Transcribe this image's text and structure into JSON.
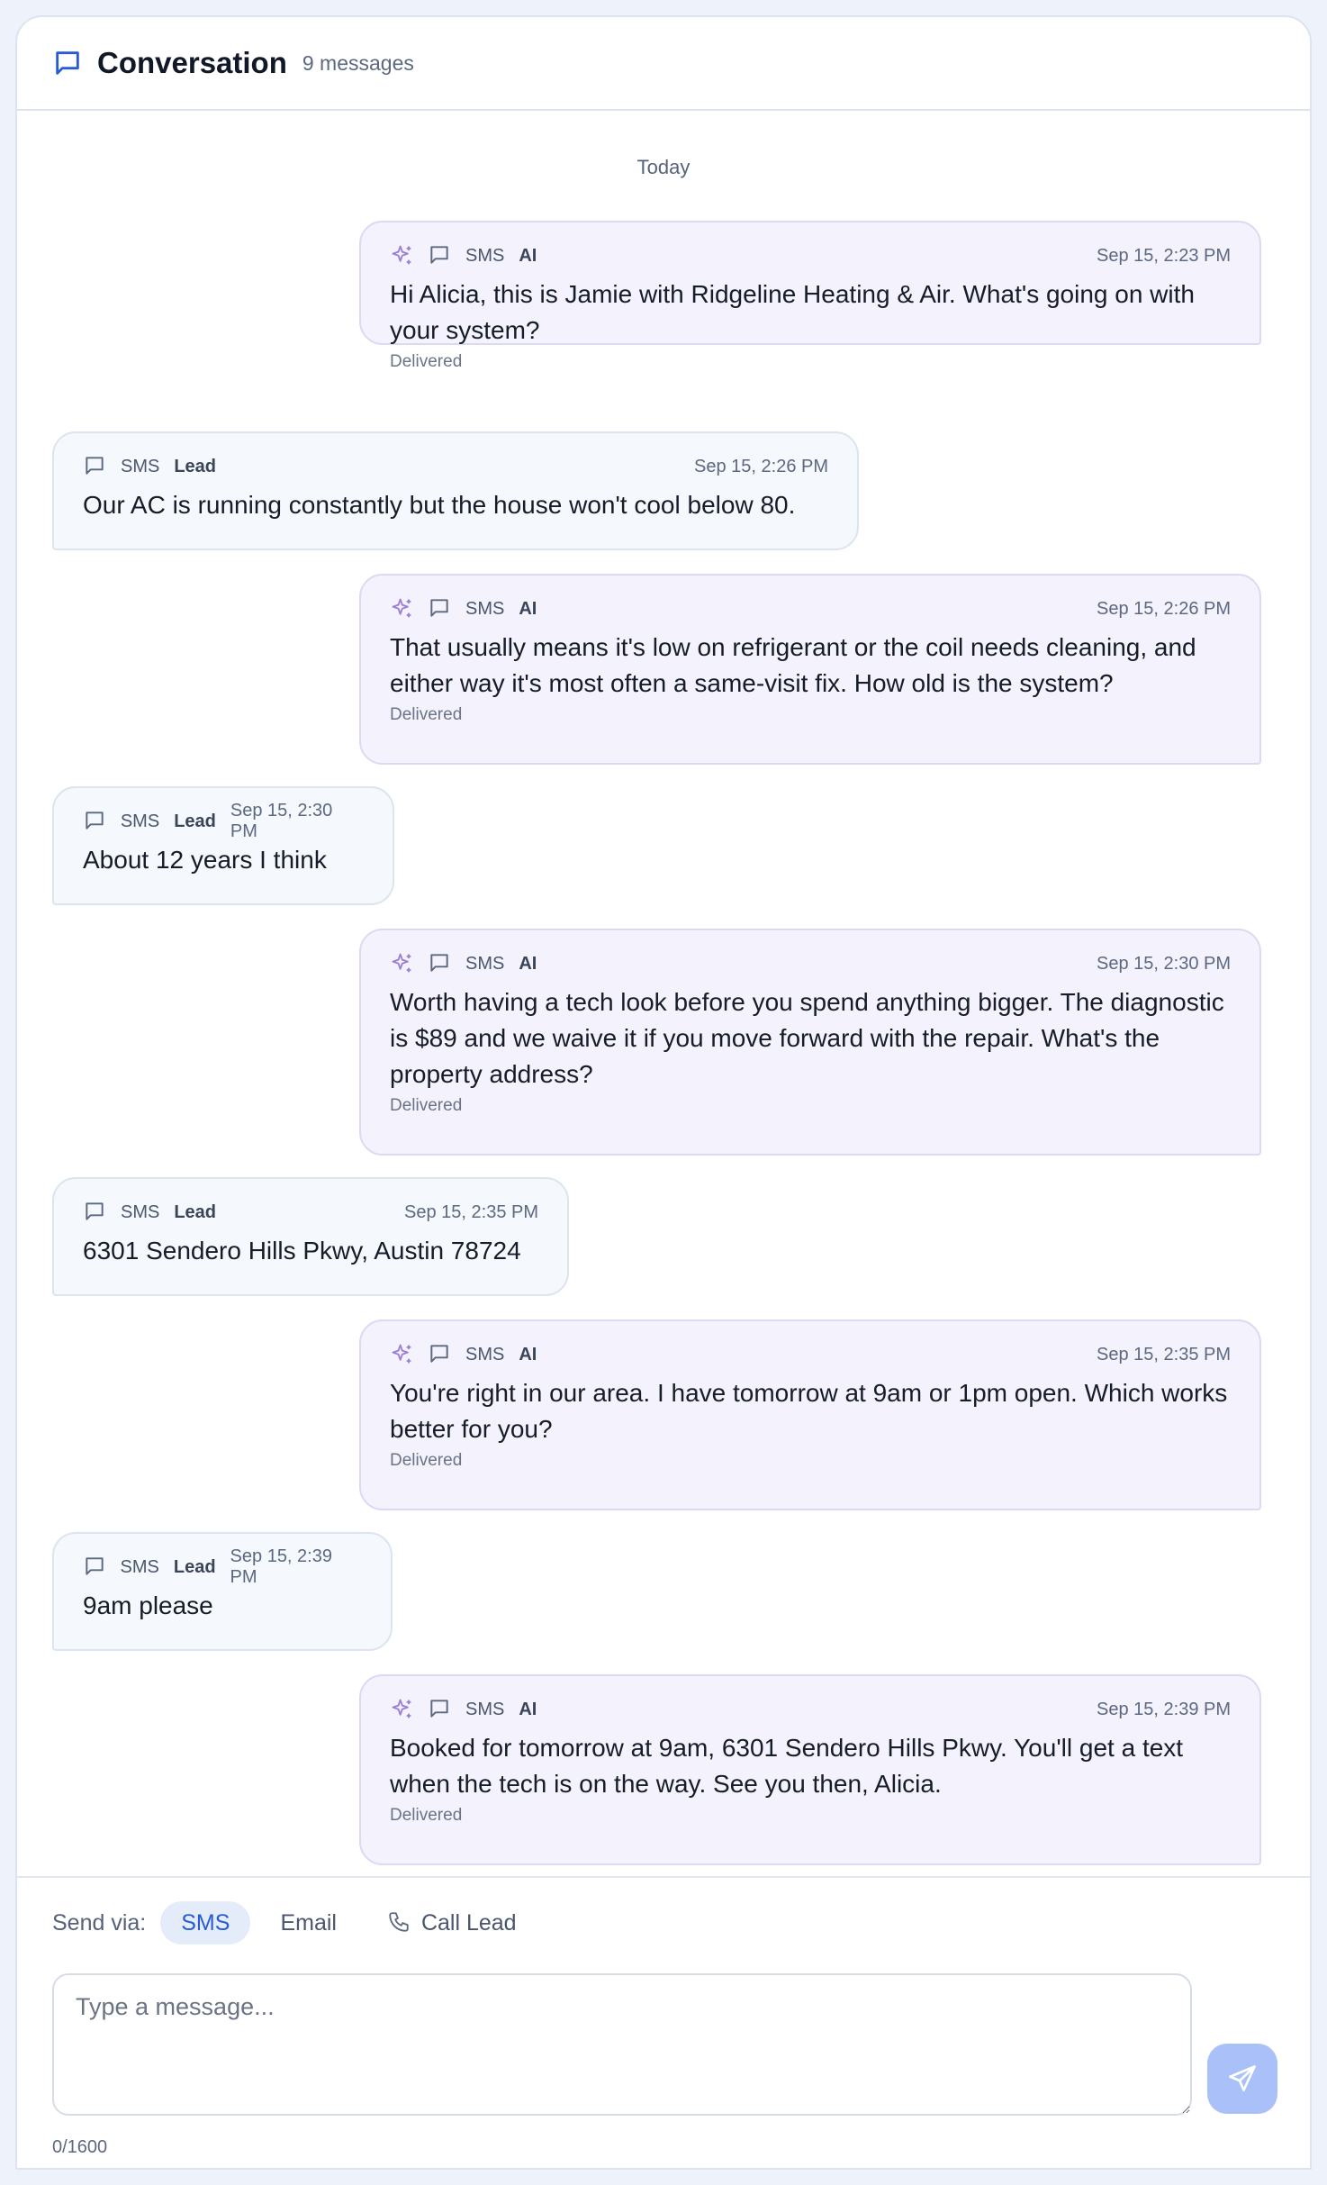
{
  "header": {
    "title": "Conversation",
    "count": "9 messages"
  },
  "date_separator": "Today",
  "colors": {
    "accent": "#2a5bd7",
    "ai_bubble": "#f3f2fd",
    "lead_bubble": "#f5f8fc",
    "ai_sparkle": "#9b7fd6",
    "send_button": "#a9c1f8"
  },
  "messages": [
    {
      "sender": "ai",
      "channel": "SMS",
      "who": "AI",
      "time": "Sep 15, 2:23 PM",
      "text": "Hi Alicia, this is Jamie with Ridgeline Heating & Air. What's going on with your system?",
      "status": "Delivered",
      "icons": [
        "sparkle-icon",
        "chat-bubble-icon"
      ]
    },
    {
      "sender": "lead",
      "channel": "SMS",
      "who": "Lead",
      "time": "Sep 15, 2:26 PM",
      "text": "Our AC is running constantly but the house won't cool below 80.",
      "icons": [
        "chat-bubble-icon"
      ]
    },
    {
      "sender": "ai",
      "channel": "SMS",
      "who": "AI",
      "time": "Sep 15, 2:26 PM",
      "text": "That usually means it's low on refrigerant or the coil needs cleaning, and either way it's most often a same-visit fix. How old is the system?",
      "status": "Delivered",
      "icons": [
        "sparkle-icon",
        "chat-bubble-icon"
      ]
    },
    {
      "sender": "lead",
      "channel": "SMS",
      "who": "Lead",
      "time": "Sep 15, 2:30 PM",
      "text": "About 12 years I think",
      "icons": [
        "chat-bubble-icon"
      ]
    },
    {
      "sender": "ai",
      "channel": "SMS",
      "who": "AI",
      "time": "Sep 15, 2:30 PM",
      "text": "Worth having a tech look before you spend anything bigger. The diagnostic is $89 and we waive it if you move forward with the repair. What's the property address?",
      "status": "Delivered",
      "icons": [
        "sparkle-icon",
        "chat-bubble-icon"
      ]
    },
    {
      "sender": "lead",
      "channel": "SMS",
      "who": "Lead",
      "time": "Sep 15, 2:35 PM",
      "text": "6301 Sendero Hills Pkwy, Austin 78724",
      "icons": [
        "chat-bubble-icon"
      ]
    },
    {
      "sender": "ai",
      "channel": "SMS",
      "who": "AI",
      "time": "Sep 15, 2:35 PM",
      "text": "You're right in our area. I have tomorrow at 9am or 1pm open. Which works better for you?",
      "status": "Delivered",
      "icons": [
        "sparkle-icon",
        "chat-bubble-icon"
      ]
    },
    {
      "sender": "lead",
      "channel": "SMS",
      "who": "Lead",
      "time": "Sep 15, 2:39 PM",
      "text": "9am please",
      "icons": [
        "chat-bubble-icon"
      ]
    },
    {
      "sender": "ai",
      "channel": "SMS",
      "who": "AI",
      "time": "Sep 15, 2:39 PM",
      "text": "Booked for tomorrow at 9am, 6301 Sendero Hills Pkwy. You'll get a text when the tech is on the way. See you then, Alicia.",
      "status": "Delivered",
      "icons": [
        "sparkle-icon",
        "chat-bubble-icon"
      ]
    }
  ],
  "composer": {
    "send_via_label": "Send via:",
    "options": [
      {
        "label": "SMS",
        "active": true
      },
      {
        "label": "Email",
        "active": false
      },
      {
        "label": "Call Lead",
        "active": false,
        "icon": "phone-icon"
      }
    ],
    "placeholder": "Type a message...",
    "value": "",
    "char_count": "0/1600",
    "send_icon": "send-icon"
  }
}
